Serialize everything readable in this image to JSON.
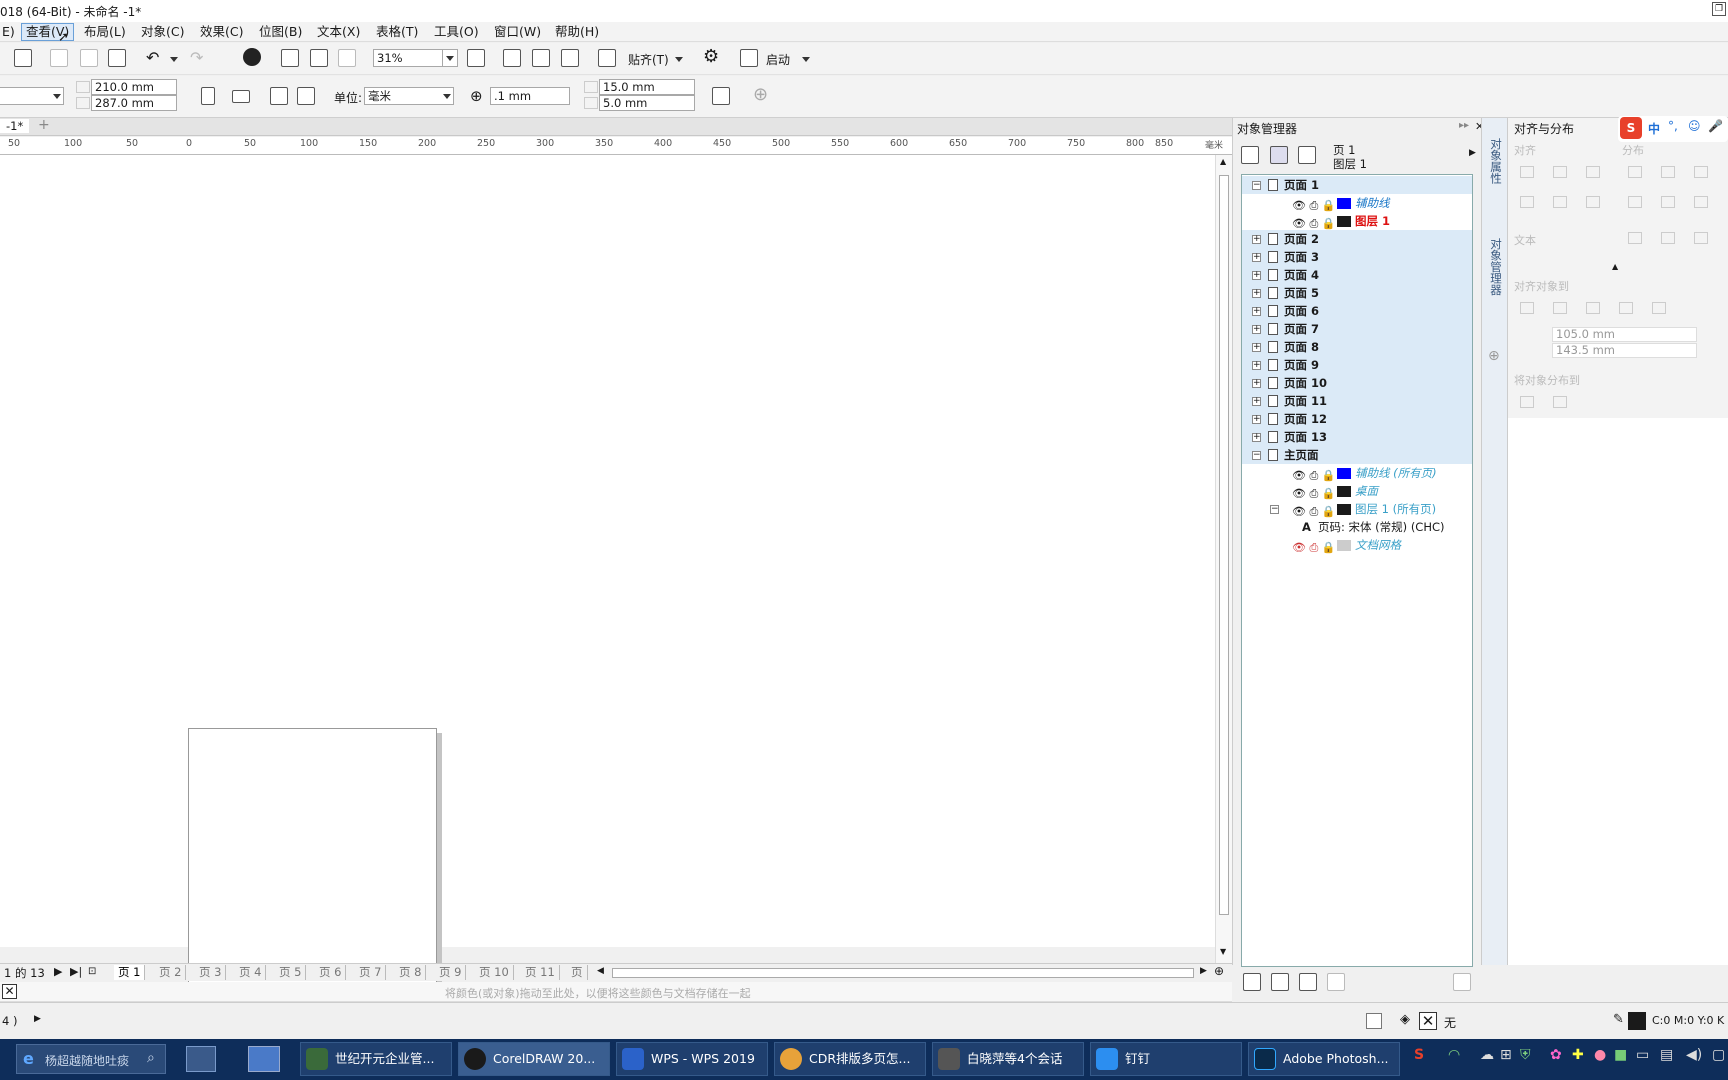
{
  "window": {
    "title": "018 (64-Bit) - 未命名 -1*"
  },
  "menu": [
    "E)",
    "查看(V)",
    "布局(L)",
    "对象(C)",
    "效果(C)",
    "位图(B)",
    "文本(X)",
    "表格(T)",
    "工具(O)",
    "窗口(W)",
    "帮助(H)"
  ],
  "toolbar": {
    "zoom": "31%",
    "snap_label": "贴齐(T)",
    "launch_label": "启动"
  },
  "propbar": {
    "width": "210.0 mm",
    "height": "287.0 mm",
    "unit_label": "单位:",
    "unit_value": "毫米",
    "nudge": ".1 mm",
    "dup_x": "15.0 mm",
    "dup_y": "5.0 mm"
  },
  "doc_tab": "-1*",
  "ruler": {
    "ticks": [
      "50",
      "100",
      "50",
      "0",
      "50",
      "100",
      "150",
      "200",
      "250",
      "300",
      "350",
      "400",
      "450",
      "500",
      "550",
      "600",
      "650",
      "700",
      "750",
      "800",
      "850"
    ],
    "unit": "毫米"
  },
  "page_tabs": {
    "counter": "1 的 13",
    "tabs": [
      "页 1",
      "页 2",
      "页 3",
      "页 4",
      "页 5",
      "页 6",
      "页 7",
      "页 8",
      "页 9",
      "页 10",
      "页 11",
      "页"
    ]
  },
  "palette_hint": "将颜色(或对象)拖动至此处，以便将这些颜色与文档存储在一起",
  "status": {
    "left": "4 )",
    "fill_label": "无",
    "color_readout": "C:0 M:0 Y:0 K"
  },
  "object_manager": {
    "title": "对象管理器",
    "current_page": "页 1",
    "current_layer": "图层 1",
    "pages": [
      {
        "name": "页面 1",
        "layers": [
          {
            "name": "辅助线",
            "color": "#0000ff",
            "style": "guide"
          },
          {
            "name": "图层 1",
            "color": "#1a1a1a",
            "style": "active"
          }
        ]
      },
      {
        "name": "页面 2"
      },
      {
        "name": "页面 3"
      },
      {
        "name": "页面 4"
      },
      {
        "name": "页面 5"
      },
      {
        "name": "页面 6"
      },
      {
        "name": "页面 7"
      },
      {
        "name": "页面 8"
      },
      {
        "name": "页面 9"
      },
      {
        "name": "页面 10"
      },
      {
        "name": "页面 11"
      },
      {
        "name": "页面 12"
      },
      {
        "name": "页面 13"
      }
    ],
    "master": {
      "name": "主页面",
      "layers": [
        {
          "name": "辅助线 (所有页)",
          "color": "#0000ff"
        },
        {
          "name": "桌面",
          "color": "#1a1a1a"
        },
        {
          "name": "图层 1 (所有页)",
          "color": "#1a1a1a"
        },
        {
          "name": "页码: 宋体 (常规) (CHC)",
          "color": ""
        },
        {
          "name": "文档网格",
          "color": "#cccccc"
        }
      ]
    }
  },
  "side_tabs": [
    "对象属性",
    "对象管理器"
  ],
  "align_panel": {
    "title": "对齐与分布",
    "align_label": "对齐",
    "distribute_label": "分布",
    "text_label": "文本",
    "align_to_label": "对齐对象到",
    "x": "105.0 mm",
    "y": "143.5 mm",
    "distribute_to_label": "将对象分布到"
  },
  "taskbar": {
    "search_placeholder": "杨超越随地吐痰",
    "tasks": [
      {
        "label": "世纪开元企业管...",
        "color": "#3a6a3a"
      },
      {
        "label": "CorelDRAW 20...",
        "color": "#1a1a1a"
      },
      {
        "label": "WPS - WPS 2019",
        "color": "#2b62c9"
      },
      {
        "label": "CDR排版多页怎...",
        "color": "#e7a23a"
      },
      {
        "label": "白晓萍等4个会话",
        "color": "#555555"
      },
      {
        "label": "钉钉",
        "color": "#2c8ef0"
      },
      {
        "label": "Adobe Photosh...",
        "color": "#0a2a4a"
      }
    ],
    "ime": "中"
  }
}
